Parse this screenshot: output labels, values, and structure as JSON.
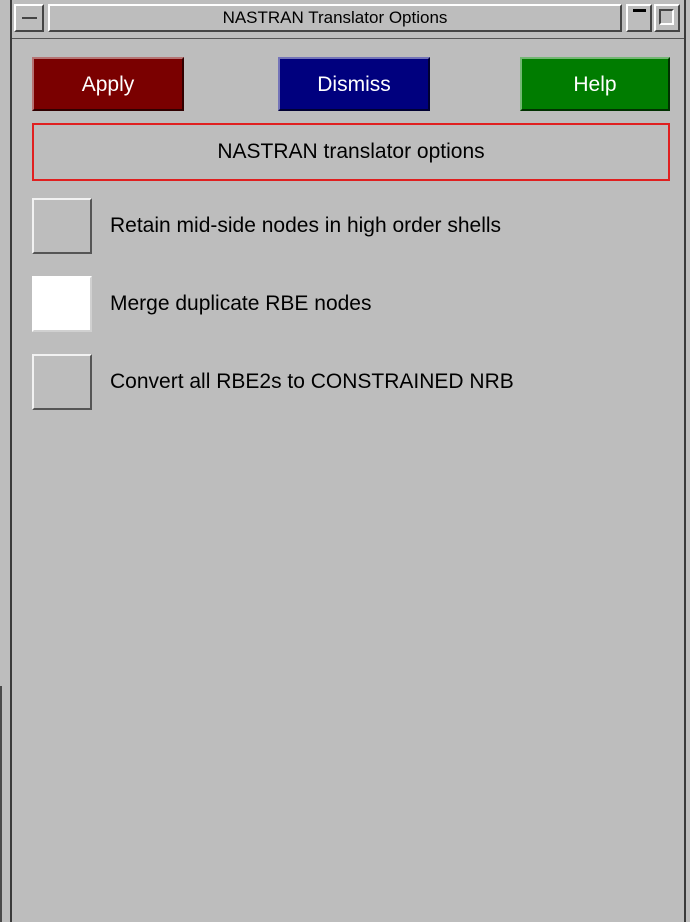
{
  "window": {
    "title": "NASTRAN Translator Options"
  },
  "toolbar": {
    "apply_label": "Apply",
    "dismiss_label": "Dismiss",
    "help_label": "Help"
  },
  "section": {
    "header": "NASTRAN translator options"
  },
  "options": [
    {
      "label": "Retain mid-side nodes in high order shells",
      "checked": false
    },
    {
      "label": "Merge duplicate RBE nodes",
      "checked": true
    },
    {
      "label": "Convert all RBE2s to CONSTRAINED NRB",
      "checked": false
    }
  ],
  "colors": {
    "background": "#bdbdbd",
    "apply": "#7a0000",
    "dismiss": "#00007e",
    "help": "#007c00",
    "section_border": "#e02020",
    "checked_box": "#ffffff"
  }
}
